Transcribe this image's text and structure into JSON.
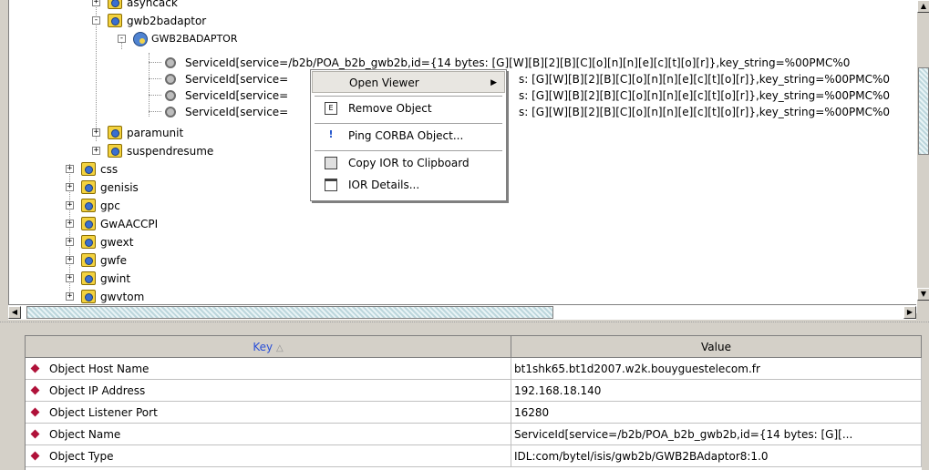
{
  "tree": {
    "items": [
      {
        "label": "asyncack",
        "expander": "+"
      },
      {
        "label": "gwb2badaptor",
        "expander": "-"
      },
      {
        "label": "GWB2BADAPTOR",
        "expander": "-"
      },
      {
        "label": "ServiceId[service=/b2b/POA_b2b_gwb2b,id={14 bytes: [G][W][B][2][B][C][o][n][n][e][c][t][o][r]},key_string=%00PMC%0"
      },
      {
        "label": "ServiceId[service=",
        "label_tail": "s: [G][W][B][2][B][C][o][n][n][e][c][t][o][r]},key_string=%00PMC%0"
      },
      {
        "label": "ServiceId[service=",
        "label_tail": "s: [G][W][B][2][B][C][o][n][n][e][c][t][o][r]},key_string=%00PMC%0"
      },
      {
        "label": "ServiceId[service=",
        "label_tail": "s: [G][W][B][2][B][C][o][n][n][e][c][t][o][r]},key_string=%00PMC%0"
      },
      {
        "label": "paramunit",
        "expander": "+"
      },
      {
        "label": "suspendresume",
        "expander": "+"
      },
      {
        "label": "css",
        "expander": "+"
      },
      {
        "label": "genisis",
        "expander": "+"
      },
      {
        "label": "gpc",
        "expander": "+"
      },
      {
        "label": "GwAACCPI",
        "expander": "+"
      },
      {
        "label": "gwext",
        "expander": "+"
      },
      {
        "label": "gwfe",
        "expander": "+"
      },
      {
        "label": "gwint",
        "expander": "+"
      },
      {
        "label": "gwvtom",
        "expander": "+"
      }
    ]
  },
  "context_menu": {
    "items": [
      {
        "label": "Open Viewer",
        "icon": "none",
        "submenu": "▶"
      },
      {
        "label": "Remove Object",
        "icon": "remove-object-icon"
      },
      {
        "label": "Ping CORBA Object...",
        "icon": "exclamation-icon"
      },
      {
        "label": "Copy IOR to Clipboard",
        "icon": "copy-icon"
      },
      {
        "label": "IOR Details...",
        "icon": "details-icon"
      }
    ]
  },
  "properties": {
    "columns": {
      "key": "Key",
      "sort_indicator": "△",
      "value": "Value"
    },
    "rows": [
      {
        "key": "Object Host Name",
        "value": "bt1shk65.bt1d2007.w2k.bouyguestelecom.fr"
      },
      {
        "key": "Object IP Address",
        "value": "192.168.18.140"
      },
      {
        "key": "Object Listener Port",
        "value": "16280"
      },
      {
        "key": "Object Name",
        "value": "ServiceId[service=/b2b/POA_b2b_gwb2b,id={14 bytes: [G][..."
      },
      {
        "key": "Object Type",
        "value": "IDL:com/bytel/isis/gwb2b/GWB2BAdaptor8:1.0"
      }
    ]
  },
  "scrollbars": {
    "arrow_up": "▲",
    "arrow_down": "▼",
    "arrow_left": "◀",
    "arrow_right": "▶"
  },
  "colors": {
    "menu_selected": "#e8e6e1",
    "folder": "#f3d23f",
    "key_diamond": "#b0123a"
  }
}
